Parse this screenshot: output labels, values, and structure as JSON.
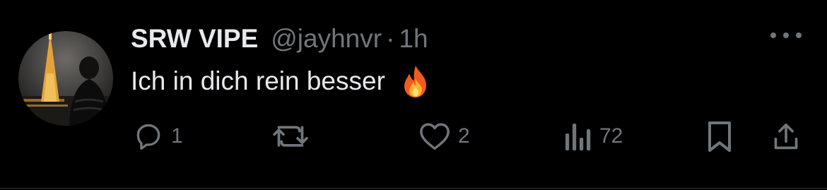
{
  "post": {
    "display_name": "SRW VIPE",
    "handle": "@jayhnvr",
    "separator": "·",
    "time": "1h",
    "text": "Ich in dich rein besser",
    "emoji": "fire-icon"
  },
  "actions": {
    "reply_count": "1",
    "repost_count": "",
    "like_count": "2",
    "views_count": "72"
  },
  "colors": {
    "background": "#000000",
    "primary_text": "#e7e9ea",
    "secondary_text": "#71767b",
    "divider": "#2f3336"
  }
}
